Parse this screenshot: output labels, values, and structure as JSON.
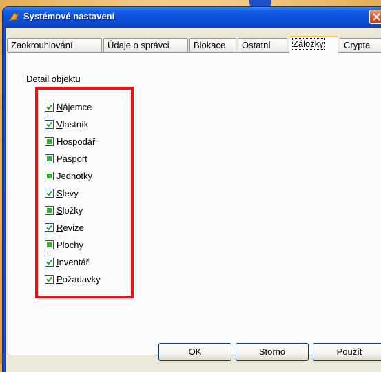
{
  "window": {
    "title": "Systémové nastavení"
  },
  "tabs": [
    {
      "label": "Zaokrouhlování"
    },
    {
      "label": "Údaje o správci"
    },
    {
      "label": "Blokace"
    },
    {
      "label": "Ostatní"
    },
    {
      "label": "Záložky",
      "active": true
    },
    {
      "label": "Crypta"
    }
  ],
  "section": {
    "label": "Detail objektu"
  },
  "items": [
    {
      "ul": "N",
      "rest": "ájemce",
      "state": "checked"
    },
    {
      "ul": "V",
      "rest": "lastník",
      "state": "checked"
    },
    {
      "ul": "",
      "rest": "Hospodář",
      "state": "partial"
    },
    {
      "ul": "",
      "rest": "Pasport",
      "state": "partial"
    },
    {
      "ul": "",
      "rest": "Jednotky",
      "state": "partial"
    },
    {
      "ul": "S",
      "rest": "levy",
      "state": "checked"
    },
    {
      "ul": "S",
      "rest": "ložky",
      "state": "partial"
    },
    {
      "ul": "R",
      "rest": "evize",
      "state": "checked"
    },
    {
      "ul": "P",
      "rest": "lochy",
      "state": "partial"
    },
    {
      "ul": "I",
      "rest": "nventář",
      "state": "checked"
    },
    {
      "ul": "P",
      "rest": "ožadavky",
      "state": "checked"
    }
  ],
  "buttons": {
    "ok": "OK",
    "cancel": "Storno",
    "apply": "Použít"
  },
  "colors": {
    "accent": "#e81414",
    "title_bar": "#0a4fd8"
  }
}
